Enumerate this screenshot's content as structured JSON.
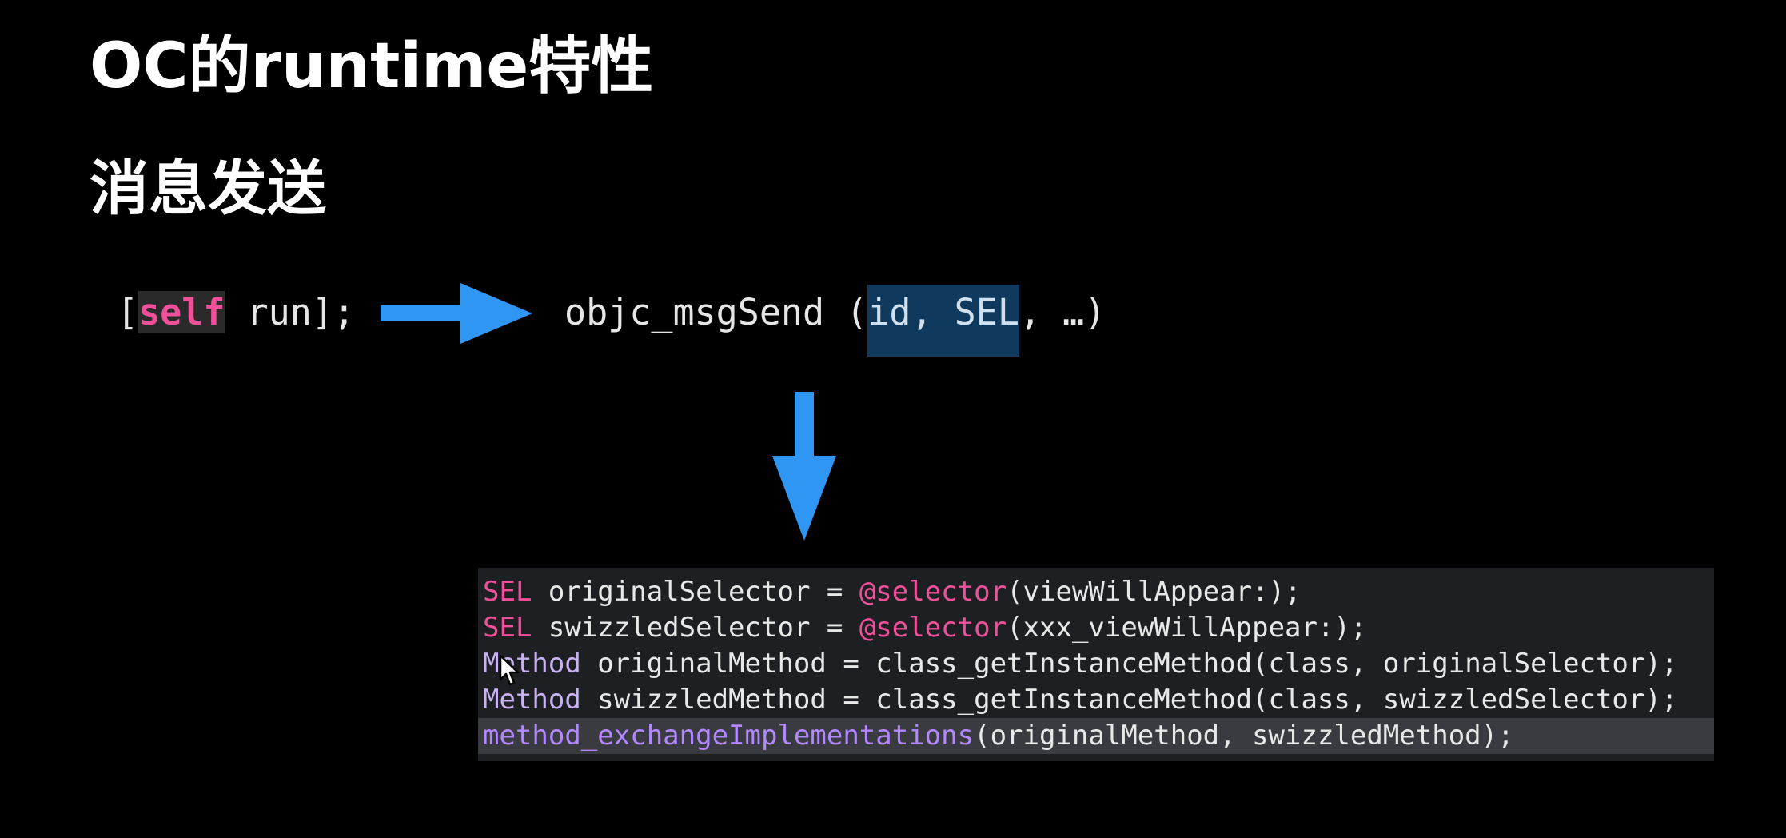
{
  "slide": {
    "title": "OC的runtime特性",
    "subtitle": "消息发送",
    "colors": {
      "background": "#000000",
      "arrow": "#2f96f3",
      "keyword": "#f0509a",
      "selection": "#0f3a5e",
      "code_background": "#1e1f22"
    }
  },
  "message_call": {
    "open": "[",
    "keyword": "self",
    "rest": " run];"
  },
  "arrows": {
    "right": "arrow-right-icon",
    "down": "arrow-down-icon"
  },
  "msgsend": {
    "func": "objc_msgSend",
    "open_paren": "(",
    "highlighted_args": "id, SEL",
    "rest": ", …)"
  },
  "code": {
    "lines": [
      {
        "type": "SEL",
        "var": " originalSelector = ",
        "at": "@selector",
        "rest": "(viewWillAppear:);"
      },
      {
        "type": "SEL",
        "var": " swizzledSelector = ",
        "at": "@selector",
        "rest": "(xxx_viewWillAppear:);"
      },
      {
        "type": "Method",
        "rest": " originalMethod = class_getInstanceMethod(class, originalSelector);"
      },
      {
        "type": "Method",
        "rest": " swizzledMethod = class_getInstanceMethod(class, swizzledSelector);"
      },
      {
        "func": "method_exchangeImplementations",
        "rest": "(originalMethod, swizzledMethod);"
      }
    ],
    "cursor_icon": "mouse-pointer-icon"
  }
}
